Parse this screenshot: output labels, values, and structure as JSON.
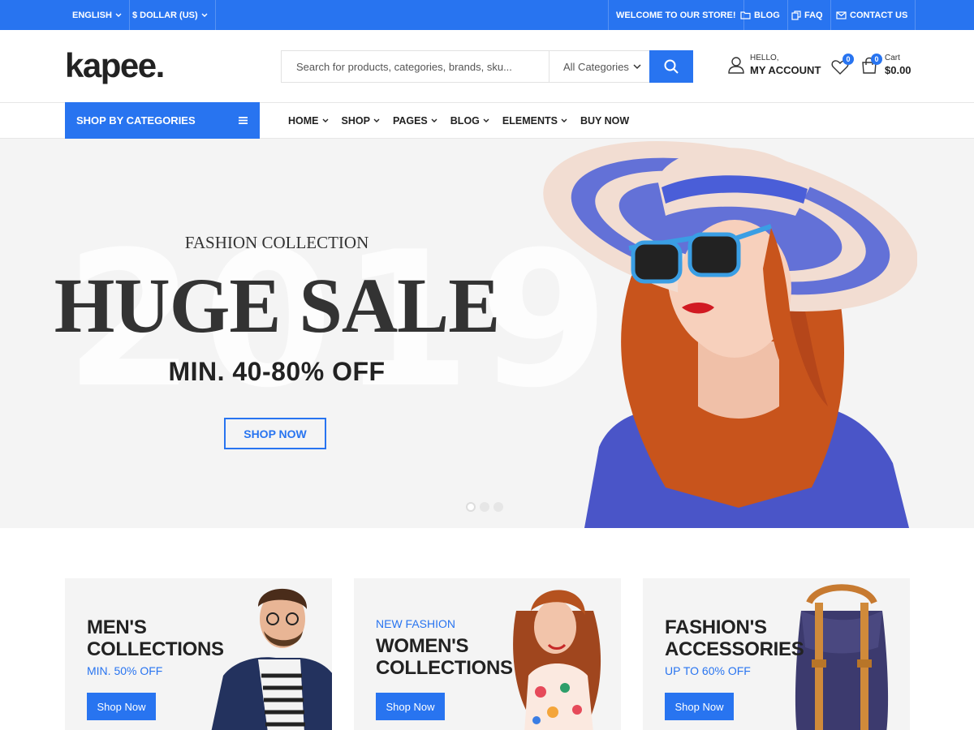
{
  "topbar": {
    "language": "ENGLISH",
    "currency": "$ DOLLAR (US)",
    "welcome": "WELCOME TO OUR STORE!",
    "blog": "BLOG",
    "faq": "FAQ",
    "contact": "CONTACT US"
  },
  "header": {
    "logo": "kapee.",
    "search_placeholder": "Search for products, categories, brands, sku...",
    "category": "All Categories",
    "hello": "HELLO,",
    "account": "MY ACCOUNT",
    "wishlist_count": "0",
    "cart_count": "0",
    "cart_label": "Cart",
    "cart_total": "$0.00"
  },
  "nav": {
    "shop_by": "SHOP BY CATEGORIES",
    "items": [
      {
        "label": "HOME"
      },
      {
        "label": "SHOP"
      },
      {
        "label": "PAGES"
      },
      {
        "label": "BLOG"
      },
      {
        "label": "ELEMENTS"
      },
      {
        "label": "BUY NOW"
      }
    ]
  },
  "hero": {
    "year": "2019",
    "subtitle": "FASHION COLLECTION",
    "headline": "HUGE SALE",
    "offer": "MIN. 40-80% OFF",
    "button": "SHOP NOW"
  },
  "cards": [
    {
      "eyebrow": "",
      "title1": "MEN'S",
      "title2": "COLLECTIONS",
      "subtitle": "MIN. 50% OFF",
      "button": "Shop Now"
    },
    {
      "eyebrow": "NEW FASHION",
      "title1": "WOMEN'S",
      "title2": "COLLECTIONS",
      "subtitle": "",
      "button": "Shop Now"
    },
    {
      "eyebrow": "",
      "title1": "FASHION'S",
      "title2": "ACCESSORIES",
      "subtitle": "UP TO 60% OFF",
      "button": "Shop Now"
    }
  ],
  "colors": {
    "primary": "#2874f0",
    "hero_bg": "#f4f4f4"
  }
}
